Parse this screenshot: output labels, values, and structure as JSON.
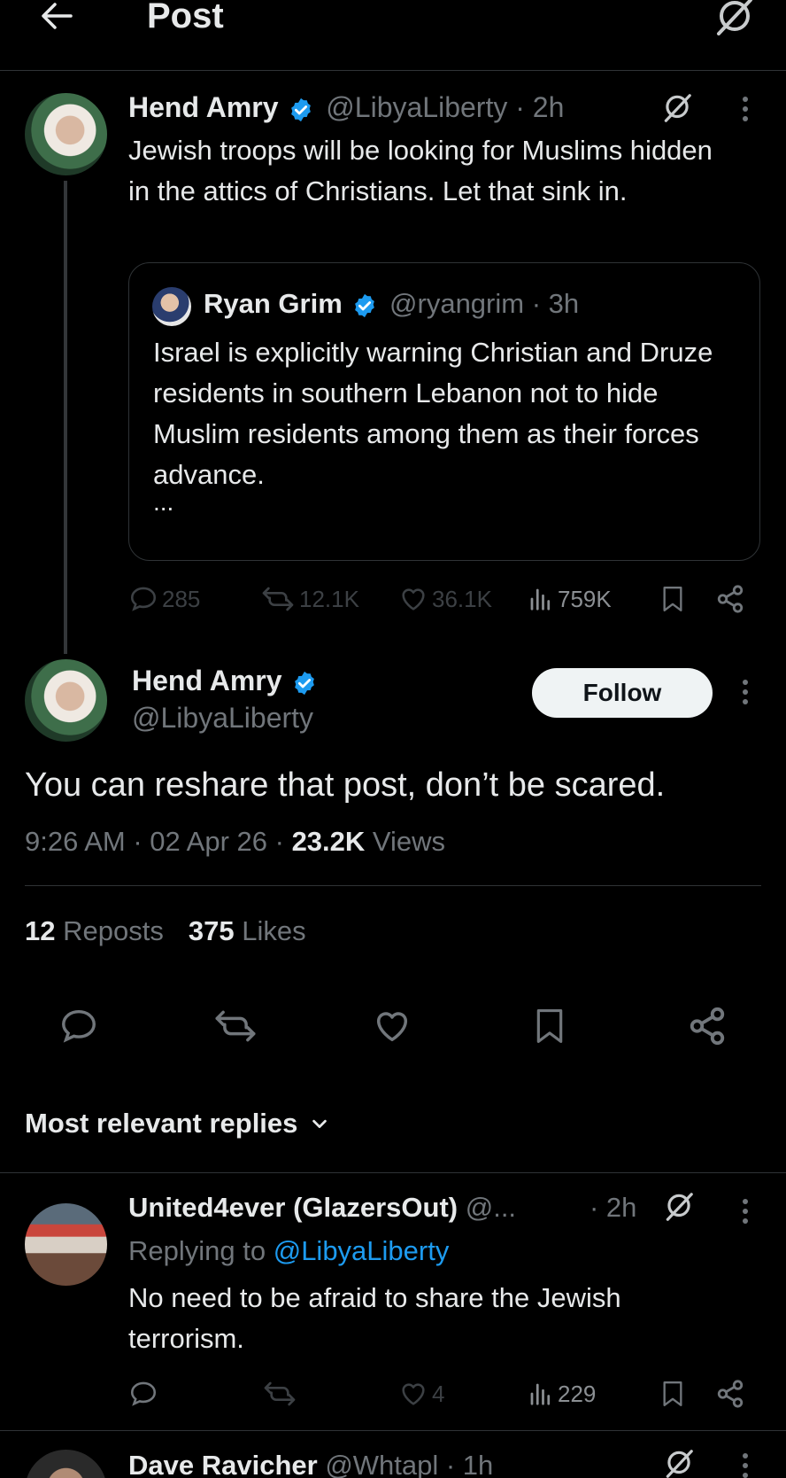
{
  "header": {
    "title": "Post"
  },
  "parent_post": {
    "author_name": "Hend Amry",
    "handle_time": "@LibyaLiberty · 2h",
    "text": "Jewish troops will be looking for Muslims hidden in the attics of Christians. Let that sink in.",
    "quote": {
      "author_name": "Ryan Grim",
      "handle_time": "@ryangrim · 3h",
      "text": "Israel is explicitly warning Christian and Druze residents in southern Lebanon not to hide Muslim residents among them as their forces advance.",
      "more": "..."
    },
    "stats": {
      "replies": "285",
      "reposts": "12.1K",
      "likes": "36.1K",
      "views": "759K"
    }
  },
  "main_post": {
    "author_name": "Hend Amry",
    "handle": "@LibyaLiberty",
    "follow_label": "Follow",
    "text": "You can reshare that post, don’t be scared.",
    "time_date": "9:26 AM · 02 Apr 26 · ",
    "views_count": "23.2K",
    "views_label": " Views",
    "reposts_count": "12",
    "reposts_label": "Reposts",
    "likes_count": "375",
    "likes_label": "Likes"
  },
  "replies_filter": {
    "label": "Most relevant replies"
  },
  "reply1": {
    "author_name": "United4ever (GlazersOut)",
    "handle": "@...",
    "time": "· 2h",
    "replying_prefix": "Replying to ",
    "replying_handle": "@LibyaLiberty",
    "text": "No need to be afraid to share the Jewish terrorism.",
    "stats": {
      "replies": "",
      "reposts": "",
      "likes": "4",
      "views": "229"
    }
  },
  "reply2": {
    "author_name": "Dave Ravicher",
    "handle_time": "@Whtapl · 1h"
  },
  "colors": {
    "accent": "#1d9bf0",
    "background": "#000000",
    "text": "#e7e9ea",
    "muted": "#71767b",
    "divider": "#2f3336"
  }
}
